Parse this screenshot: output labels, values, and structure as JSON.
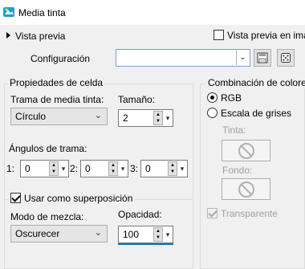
{
  "window": {
    "title": "Media tinta"
  },
  "preview": {
    "label": "Vista previa",
    "live_label": "Vista previa en ima"
  },
  "config": {
    "label": "Configuración",
    "value": ""
  },
  "cell": {
    "group_label": "Propiedades de celda",
    "pattern_label": "Trama de media tinta:",
    "pattern_value": "Círculo",
    "size_label": "Tamaño:",
    "size_value": "2"
  },
  "angles": {
    "group_label": "Ángulos de trama:",
    "items": [
      {
        "label": "1:",
        "value": "0"
      },
      {
        "label": "2:",
        "value": "0"
      },
      {
        "label": "3:",
        "value": "0"
      }
    ]
  },
  "overlay": {
    "label": "Usar como superposición",
    "blend_label": "Modo de mezcla:",
    "blend_value": "Oscurecer",
    "opacity_label": "Opacidad:",
    "opacity_value": "100"
  },
  "color": {
    "group_label": "Combinación de colore",
    "rgb_label": "RGB",
    "gray_label": "Escala de grises",
    "ink_label": "Tinta:",
    "bg_label": "Fondo:",
    "transparent_label": "Transparente"
  },
  "colors": {
    "accent": "#0078d7",
    "focus_border": "#7a9cd3",
    "panel": "#f0f0f0"
  },
  "icons": [
    "app-icon",
    "save-icon",
    "random-dice-icon",
    "chevron-down-icon",
    "no-symbol-icon"
  ]
}
